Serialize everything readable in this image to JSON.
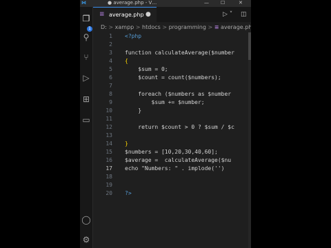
{
  "titlebar": {
    "app_icon": "vscode-icon",
    "title": "● average.php - V…",
    "minimize": "—",
    "maximize": "☐",
    "close": "✕"
  },
  "activity_bar": {
    "explorer_icon": "files-icon",
    "search_icon": "search-icon",
    "source_control_icon": "source-control-icon",
    "run_icon": "run-debug-icon",
    "extensions_icon": "extensions-icon",
    "remote_icon": "remote-explorer-icon",
    "account_icon": "account-icon",
    "settings_icon": "gear-icon",
    "explorer_badge": "1"
  },
  "tab": {
    "icon": "php",
    "name": "average.php",
    "modified_dot": "●"
  },
  "editor_actions": {
    "run": "▷ ˅",
    "split": "◫"
  },
  "breadcrumb": {
    "parts": [
      "D:",
      "xampp",
      "htdocs",
      "programming"
    ],
    "file_icon": "php",
    "file": "average.php",
    "more": "…",
    "separator": ">"
  },
  "code": {
    "lines": [
      {
        "n": "1",
        "t": "<?php"
      },
      {
        "n": "2",
        "t": ""
      },
      {
        "n": "3",
        "t": "function calculateAverage($number"
      },
      {
        "n": "4",
        "t": "{"
      },
      {
        "n": "5",
        "t": "    $sum = 0;"
      },
      {
        "n": "6",
        "t": "    $count = count($numbers);"
      },
      {
        "n": "7",
        "t": ""
      },
      {
        "n": "8",
        "t": "    foreach ($numbers as $number"
      },
      {
        "n": "9",
        "t": "        $sum += $number;"
      },
      {
        "n": "10",
        "t": "    }"
      },
      {
        "n": "11",
        "t": ""
      },
      {
        "n": "12",
        "t": "    return $count > 0 ? $sum / $c"
      },
      {
        "n": "13",
        "t": ""
      },
      {
        "n": "14",
        "t": "}"
      },
      {
        "n": "15",
        "t": "$numbers = [10,20,30,40,60];"
      },
      {
        "n": "16",
        "t": "$average =  calculateAverage($nu"
      },
      {
        "n": "17",
        "t": "echo \"Numbers: \" . implode('')"
      },
      {
        "n": "18",
        "t": ""
      },
      {
        "n": "19",
        "t": ""
      },
      {
        "n": "20",
        "t": "?>"
      }
    ]
  },
  "colors": {
    "keyword": "#569cd6",
    "function": "#dcdcaa",
    "variable": "#9cdcfe",
    "number": "#b5cea8",
    "string": "#ce9178",
    "editor_bg": "#1f1f1f"
  }
}
